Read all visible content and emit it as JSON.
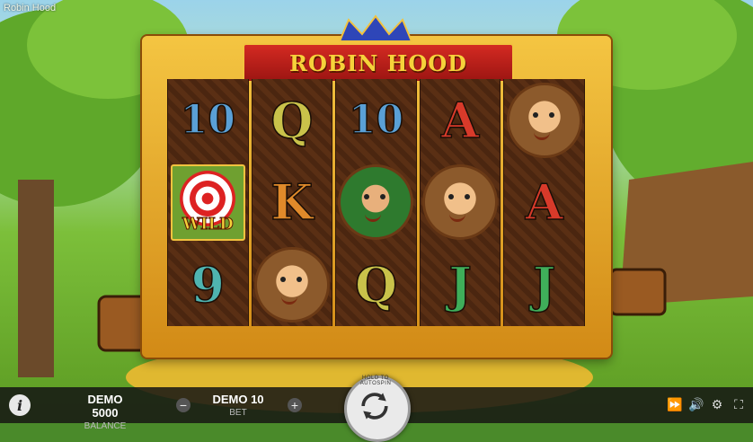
{
  "window": {
    "title": "Robin Hood"
  },
  "game": {
    "logo_text": "ROBIN HOOD"
  },
  "reels": [
    {
      "symbols": [
        {
          "type": "text",
          "value": "10",
          "cls": "sym-10"
        },
        {
          "type": "wild",
          "value": "WILD"
        },
        {
          "type": "text",
          "value": "9",
          "cls": "sym-9"
        }
      ]
    },
    {
      "symbols": [
        {
          "type": "text",
          "value": "Q",
          "cls": "sym-Q"
        },
        {
          "type": "text",
          "value": "K",
          "cls": "sym-K"
        },
        {
          "type": "portrait",
          "value": "friar-tuck"
        }
      ]
    },
    {
      "symbols": [
        {
          "type": "text",
          "value": "10",
          "cls": "sym-10"
        },
        {
          "type": "portrait",
          "value": "robin-hood"
        },
        {
          "type": "text",
          "value": "Q",
          "cls": "sym-Q"
        }
      ]
    },
    {
      "symbols": [
        {
          "type": "text",
          "value": "A",
          "cls": "sym-A"
        },
        {
          "type": "portrait",
          "value": "friar-tuck"
        },
        {
          "type": "text",
          "value": "J",
          "cls": "sym-J"
        }
      ]
    },
    {
      "symbols": [
        {
          "type": "portrait",
          "value": "friar-tuck"
        },
        {
          "type": "text",
          "value": "A",
          "cls": "sym-A"
        },
        {
          "type": "text",
          "value": "J",
          "cls": "sym-J"
        }
      ]
    }
  ],
  "bottom_bar": {
    "info_icon": "i",
    "balance_value": "DEMO 5000",
    "balance_label": "BALANCE",
    "bet_minus": "−",
    "bet_value": "DEMO 10",
    "bet_label": "BET",
    "bet_plus": "+",
    "spin_hint": "HOLD TO AUTOSPIN",
    "icons": [
      "fast-forward-icon",
      "sound-icon",
      "settings-icon",
      "fullscreen-icon"
    ]
  }
}
